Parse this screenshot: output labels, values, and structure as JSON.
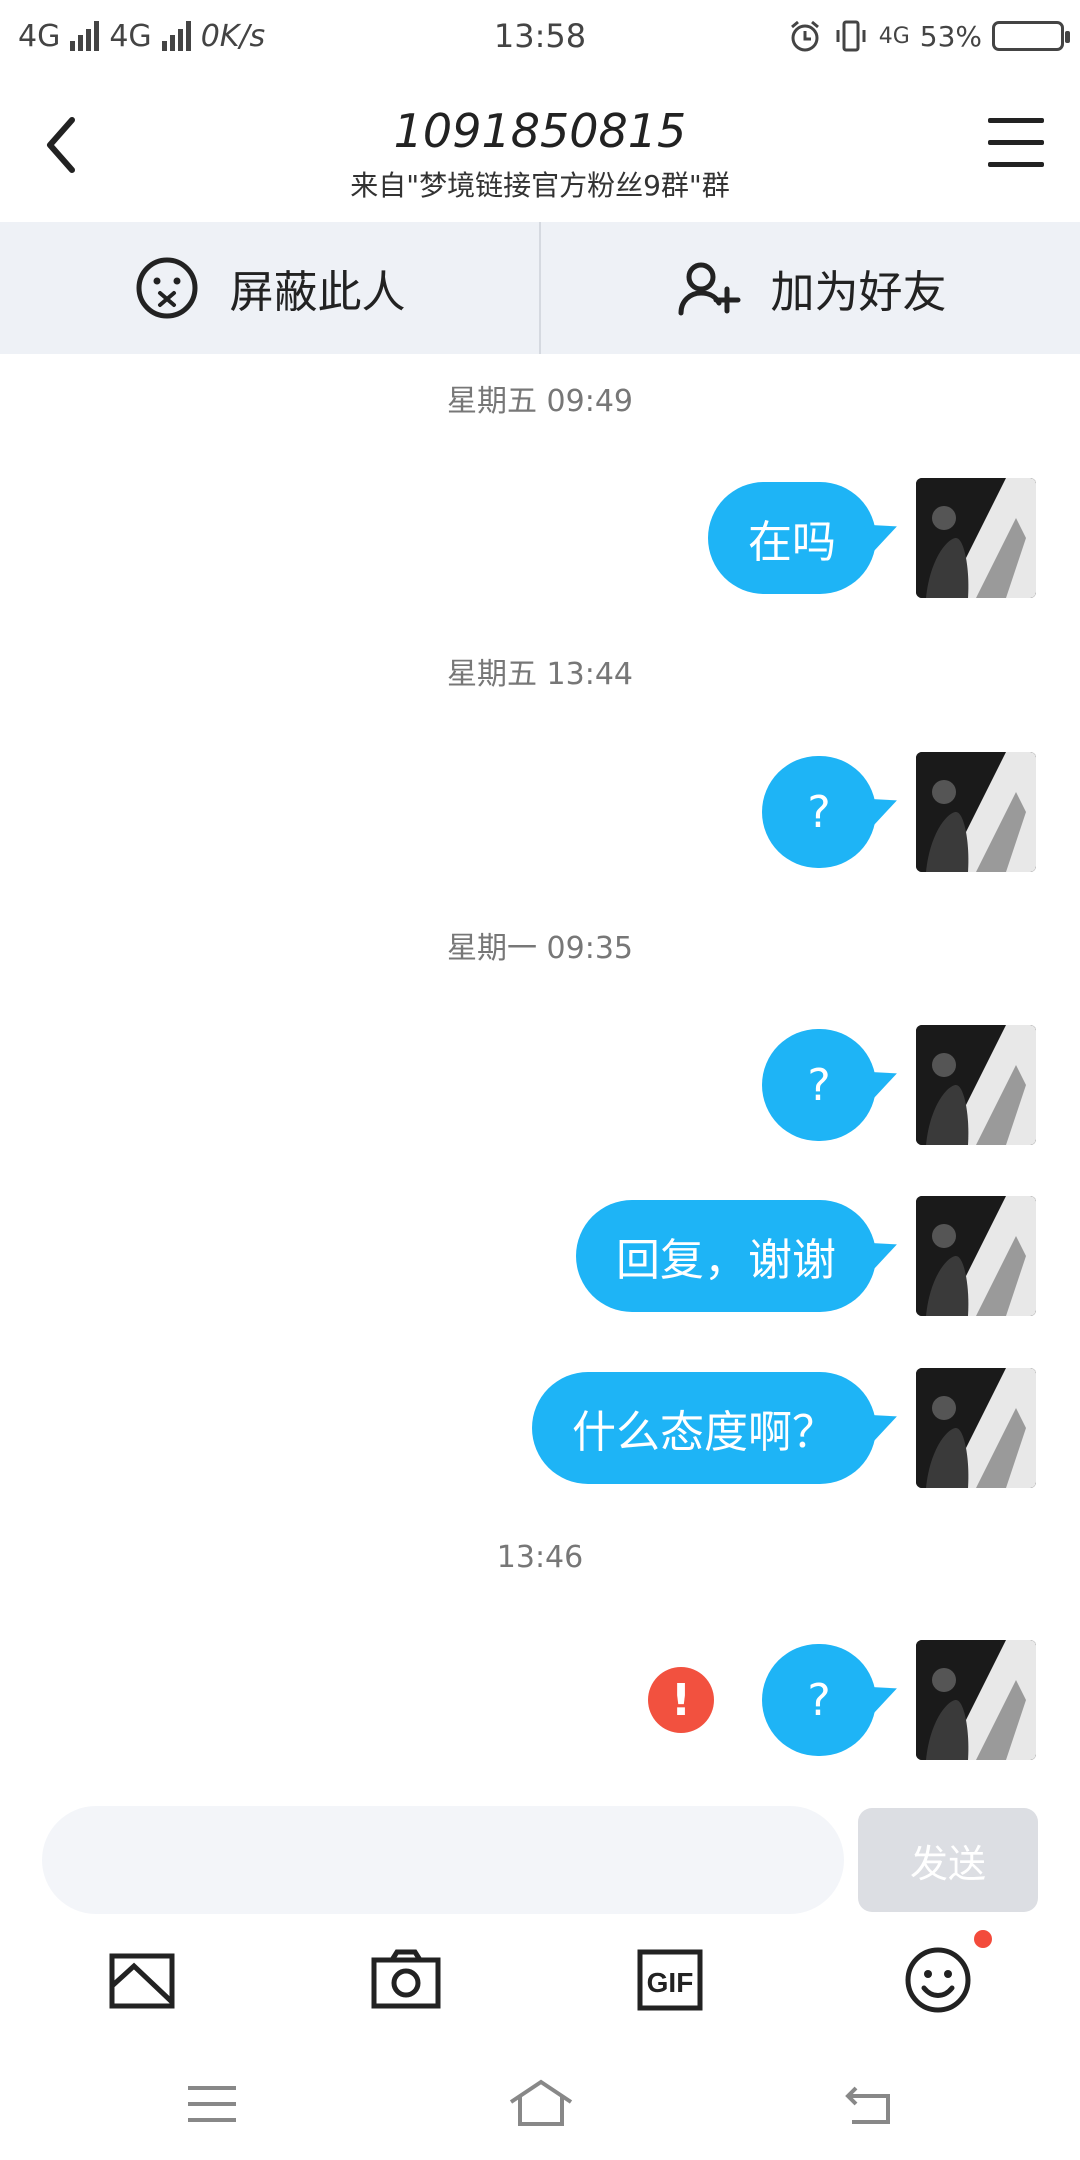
{
  "status_bar": {
    "network1": "4G",
    "network2": "4G",
    "speed": "0K/s",
    "time": "13:58",
    "network3": "4G",
    "battery": "53%",
    "battery_level": 0.53
  },
  "header": {
    "title": "1091850815",
    "subtitle": "来自\"梦境链接官方粉丝9群\"群"
  },
  "actions": {
    "block_label": "屏蔽此人",
    "add_friend_label": "加为好友"
  },
  "messages": [
    {
      "timestamp": "星期五 09:49",
      "text": "在吗"
    },
    {
      "timestamp": "星期五 13:44",
      "text": "?"
    },
    {
      "timestamp": "星期一 09:35",
      "text": "?"
    },
    {
      "timestamp": "",
      "text": "回复，谢谢"
    },
    {
      "timestamp": "",
      "text": "什么态度啊？"
    },
    {
      "timestamp": "13:46",
      "text": "?",
      "error": "!"
    }
  ],
  "composer": {
    "placeholder": "",
    "send_label": "发送"
  },
  "colors": {
    "bubble": "#1eb4f6",
    "error": "#f2513f",
    "action_bar": "#eef1f6"
  },
  "icons": [
    "back-icon",
    "menu-icon",
    "block-icon",
    "add-friend-icon",
    "image-icon",
    "camera-icon",
    "gif-icon",
    "emoji-icon",
    "nav-menu-icon",
    "nav-home-icon",
    "nav-back-icon"
  ]
}
